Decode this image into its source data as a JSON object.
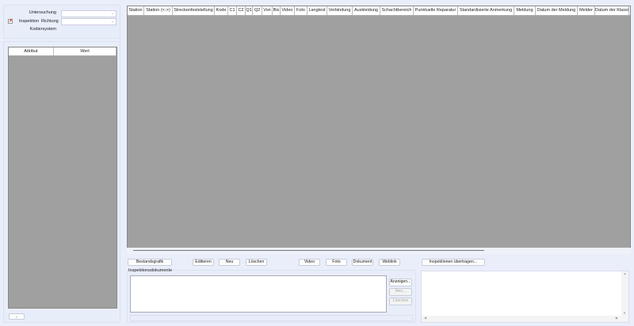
{
  "filter": {
    "untersuchung_label": "Untersuchung",
    "inspektion_label": "Inspektion",
    "richtung_label": "Richtung",
    "kodiersystem_label": "Kodiersystem",
    "untersuchung_value": "",
    "richtung_value": ""
  },
  "attr_grid": {
    "columns": [
      "Attribut",
      "Wert"
    ]
  },
  "main_grid": {
    "columns": [
      "Station",
      "Station (<->)",
      "Streckenfeststellung",
      "Kode",
      "C1",
      "C2",
      "Q1",
      "Q2",
      "Von",
      "Bis",
      "Video",
      "Foto",
      "Langtext",
      "Verbindung",
      "Auskleidung",
      "Schachtbereich",
      "Punktuelle Reparatur",
      "Standardisierte Anmerkung",
      "Meldung",
      "Datum der Meldung",
      "Melder",
      "Datum der Klassi"
    ]
  },
  "toolbar": {
    "bestandsgrafik": "Bestandsgrafik",
    "editieren": "Editieren",
    "neu": "Neu",
    "loeschen": "Löschen",
    "video": "Video",
    "foto": "Foto",
    "dokument": "Dokument",
    "weblink": "Weblink",
    "uebertragen": "Inspektionen übertragen..."
  },
  "docs": {
    "title": "Inspektionsdokumente",
    "anzeigen": "Anzeigen...",
    "neu": "Neu...",
    "loeschen": "Löschen"
  },
  "left_bottom": {
    "button": "▪"
  }
}
